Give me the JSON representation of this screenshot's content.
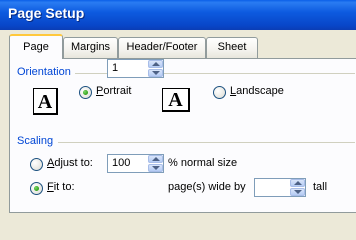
{
  "window": {
    "title": "Page Setup"
  },
  "tabs": [
    {
      "label": "Page",
      "active": true
    },
    {
      "label": "Margins",
      "active": false
    },
    {
      "label": "Header/Footer",
      "active": false
    },
    {
      "label": "Sheet",
      "active": false
    }
  ],
  "orientation": {
    "group_label": "Orientation",
    "icon_glyph": "A",
    "portrait": {
      "prefix": "",
      "access_key": "P",
      "rest": "ortrait",
      "selected": true
    },
    "landscape": {
      "prefix": "",
      "access_key": "L",
      "rest": "andscape",
      "selected": false
    }
  },
  "scaling": {
    "group_label": "Scaling",
    "adjust_to": {
      "access_key": "A",
      "rest": "djust to:",
      "value": "100",
      "suffix": "% normal size",
      "selected": false
    },
    "fit_to": {
      "access_key": "F",
      "rest": "it to:",
      "wide_value": "1",
      "wide_suffix": "page(s) wide by",
      "tall_value": "",
      "tall_suffix": "tall",
      "selected": true
    }
  },
  "colors": {
    "titlebar": "#0A5FE8",
    "group_label": "#0046D5",
    "tab_highlight": "#FFC83C",
    "radio_dot": "#2DA116"
  }
}
